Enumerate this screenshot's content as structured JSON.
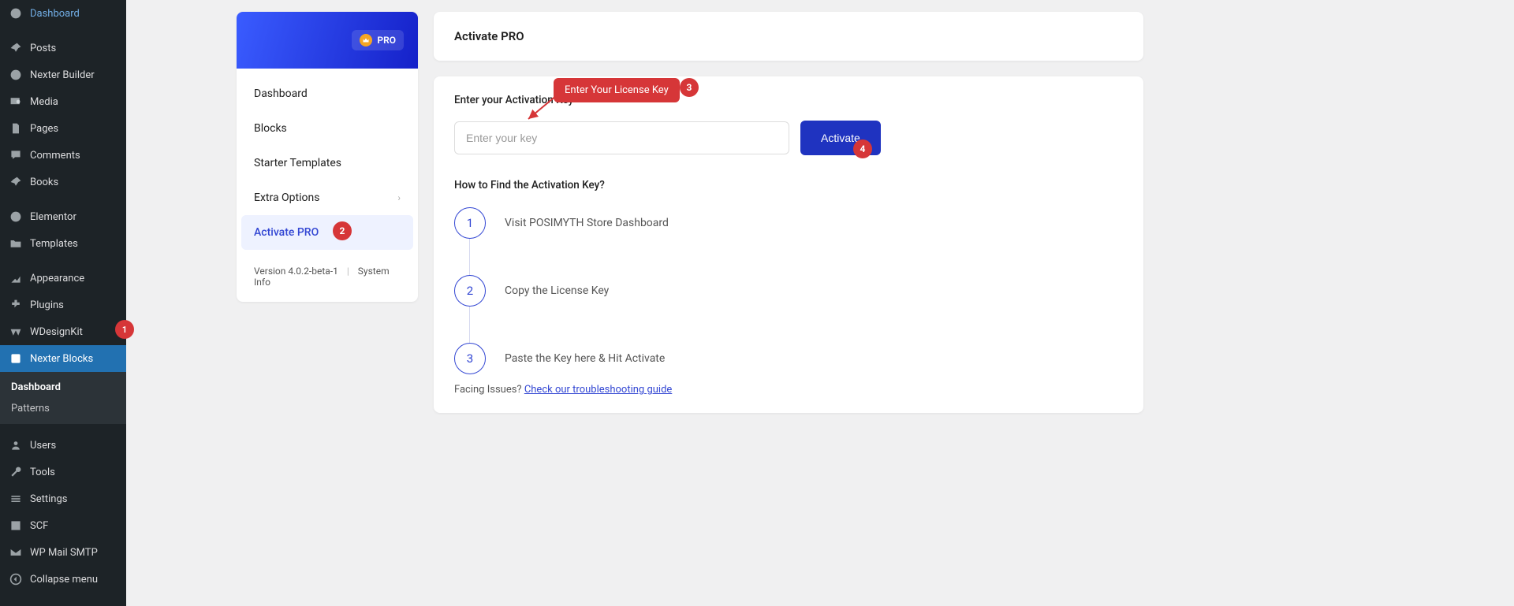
{
  "wp_menu": {
    "dashboard": "Dashboard",
    "posts": "Posts",
    "nexter_builder": "Nexter Builder",
    "media": "Media",
    "pages": "Pages",
    "comments": "Comments",
    "books": "Books",
    "elementor": "Elementor",
    "templates": "Templates",
    "appearance": "Appearance",
    "plugins": "Plugins",
    "wdesignkit": "WDesignKit",
    "nexter_blocks": "Nexter Blocks",
    "users": "Users",
    "tools": "Tools",
    "settings": "Settings",
    "scf": "SCF",
    "wp_mail": "WP Mail SMTP",
    "collapse": "Collapse menu"
  },
  "wp_submenu": {
    "dashboard": "Dashboard",
    "patterns": "Patterns"
  },
  "panel": {
    "pro_badge": "PRO",
    "nav": {
      "dashboard": "Dashboard",
      "blocks": "Blocks",
      "starter": "Starter Templates",
      "extra": "Extra Options",
      "activate": "Activate PRO"
    },
    "footer": {
      "version": "Version 4.0.2-beta-1",
      "sysinfo": "System Info"
    }
  },
  "content": {
    "title": "Activate PRO",
    "label": "Enter your Activation Key",
    "placeholder": "Enter your key",
    "activate_btn": "Activate",
    "howto": "How to Find the Activation Key?",
    "steps": {
      "s1": "Visit POSIMYTH Store Dashboard",
      "s2": "Copy the License Key",
      "s3": "Paste the Key here & Hit Activate"
    },
    "issues_text": "Facing Issues? ",
    "issues_link": "Check our troubleshooting guide"
  },
  "annotations": {
    "n1": "1",
    "n2": "2",
    "n3": "3",
    "n4": "4",
    "label3": "Enter Your License Key"
  }
}
